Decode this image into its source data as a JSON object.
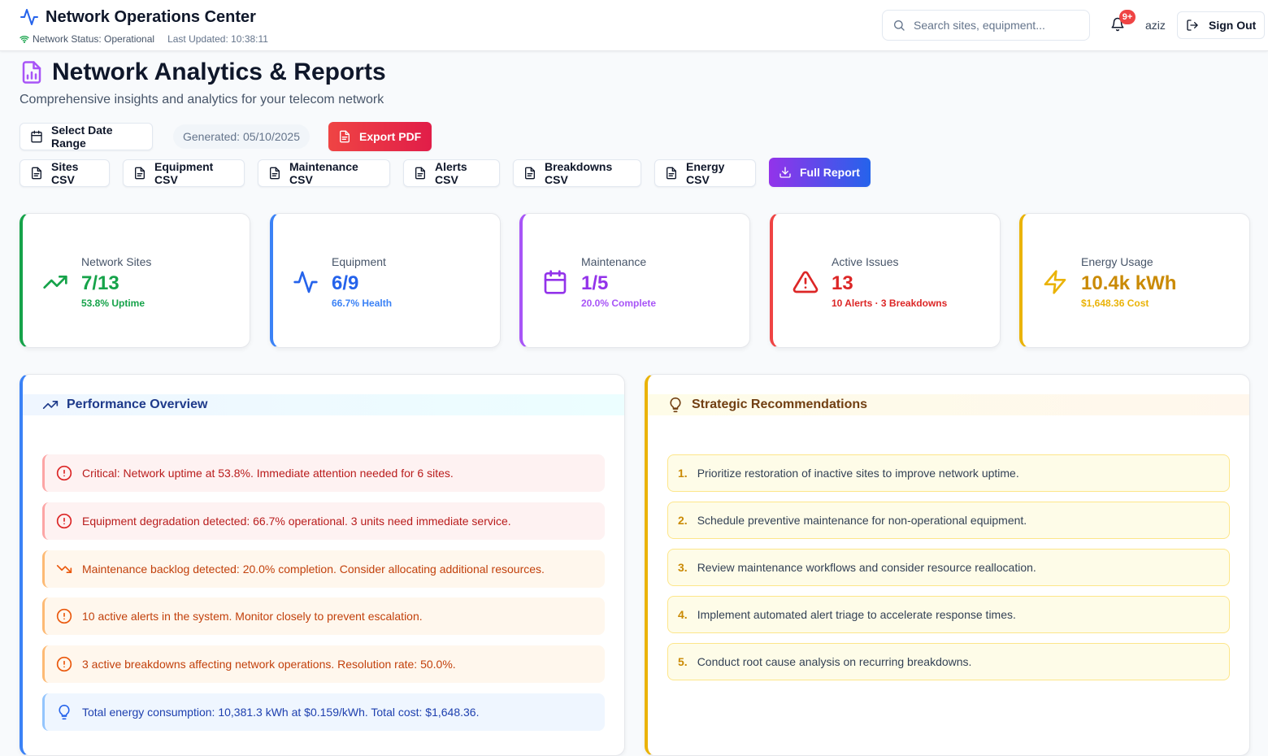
{
  "header": {
    "title": "Network Operations Center",
    "status": "Network Status: Operational",
    "last_updated": "Last Updated: 10:38:11",
    "search_placeholder": "Search sites, equipment...",
    "notif_badge": "9+",
    "user": "aziz",
    "signout": "Sign Out"
  },
  "page": {
    "title": "Network Analytics & Reports",
    "subtitle": "Comprehensive insights and analytics for your telecom network"
  },
  "toolbar": {
    "date_range": "Select Date Range",
    "generated": "Generated: 05/10/2025",
    "export_pdf": "Export PDF",
    "sites_csv": "Sites CSV",
    "equipment_csv": "Equipment CSV",
    "maintenance_csv": "Maintenance CSV",
    "alerts_csv": "Alerts CSV",
    "breakdowns_csv": "Breakdowns CSV",
    "energy_csv": "Energy CSV",
    "full_report": "Full Report"
  },
  "stats": [
    {
      "label": "Network Sites",
      "value": "7/13",
      "sub": "53.8% Uptime",
      "color": "#16a34a",
      "icon": "trending-up-icon"
    },
    {
      "label": "Equipment",
      "value": "6/9",
      "sub": "66.7% Health",
      "color": "#2563eb",
      "icon": "activity-icon"
    },
    {
      "label": "Maintenance",
      "value": "1/5",
      "sub": "20.0% Complete",
      "color": "#9333ea",
      "icon": "calendar-icon"
    },
    {
      "label": "Active Issues",
      "value": "13",
      "sub": "10 Alerts · 3 Breakdowns",
      "color": "#dc2626",
      "icon": "warning-icon"
    },
    {
      "label": "Energy Usage",
      "value": "10.4k kWh",
      "sub": "$1,648.36 Cost",
      "color": "#ca8a04",
      "icon": "lightning-icon"
    }
  ],
  "performance": {
    "title": "Performance Overview",
    "items": [
      {
        "text": "Critical: Network uptime at 53.8%. Immediate attention needed for 6 sites.",
        "icon": "alert-circle-icon"
      },
      {
        "text": "Equipment degradation detected: 66.7% operational. 3 units need immediate service.",
        "icon": "alert-circle-icon"
      },
      {
        "text": "Maintenance backlog detected: 20.0% completion. Consider allocating additional resources.",
        "icon": "trending-down-icon"
      },
      {
        "text": "10 active alerts in the system. Monitor closely to prevent escalation.",
        "icon": "alert-circle-icon"
      },
      {
        "text": "3 active breakdowns affecting network operations. Resolution rate: 50.0%.",
        "icon": "alert-circle-icon"
      },
      {
        "text": "Total energy consumption: 10,381.3 kWh at $0.159/kWh. Total cost: $1,648.36.",
        "icon": "lightbulb-icon"
      }
    ]
  },
  "recommendations": {
    "title": "Strategic Recommendations",
    "items": [
      {
        "num": "1.",
        "text": "Prioritize restoration of inactive sites to improve network uptime."
      },
      {
        "num": "2.",
        "text": "Schedule preventive maintenance for non-operational equipment."
      },
      {
        "num": "3.",
        "text": "Review maintenance workflows and consider resource reallocation."
      },
      {
        "num": "4.",
        "text": "Implement automated alert triage to accelerate response times."
      },
      {
        "num": "5.",
        "text": "Conduct root cause analysis on recurring breakdowns."
      }
    ]
  }
}
